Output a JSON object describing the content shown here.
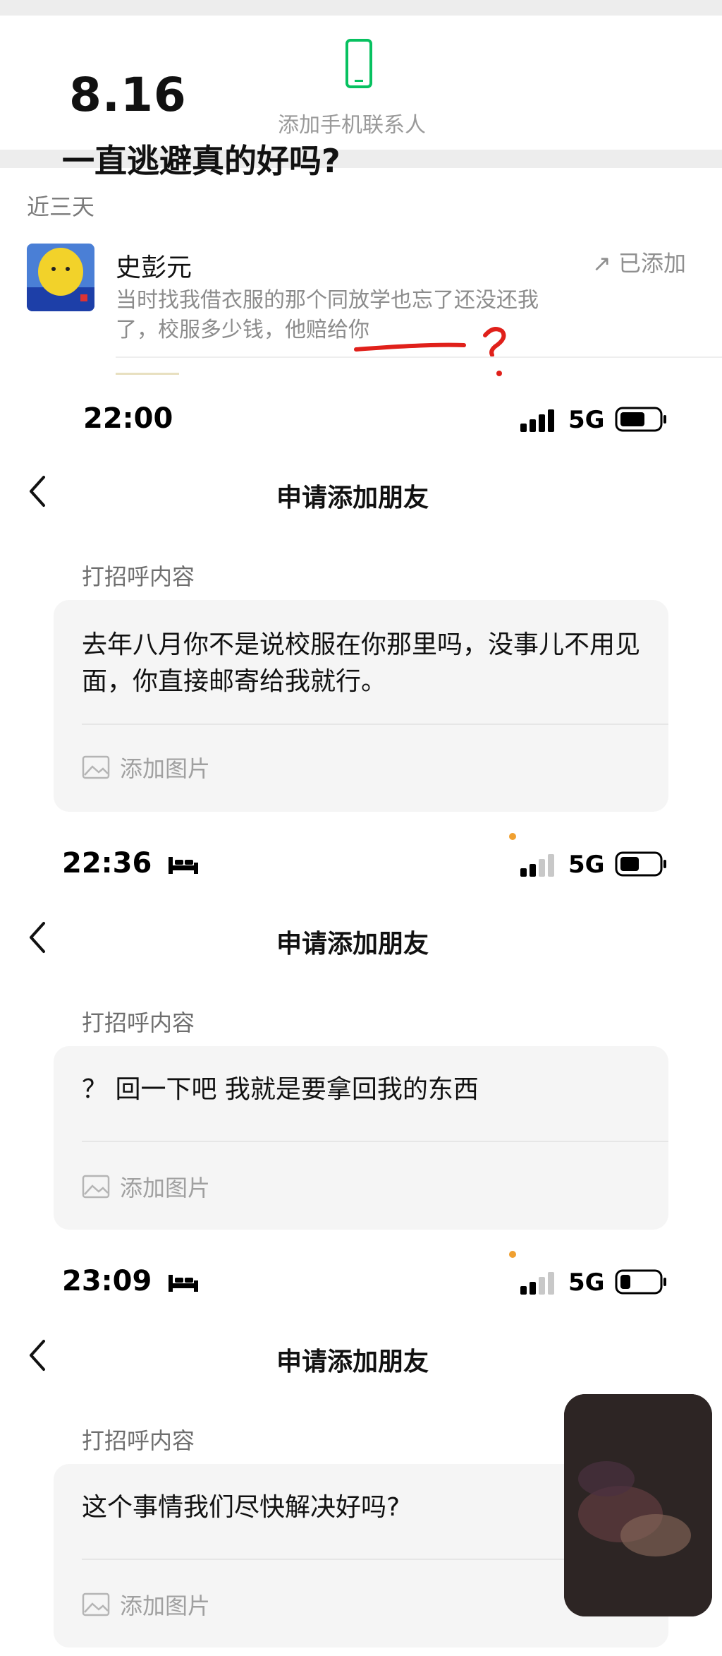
{
  "top_card": {
    "date": "8.16",
    "headline": "一直逃避真的好吗?",
    "add_contact_label": "添加手机联系人",
    "recent_label": "近三天",
    "friend": {
      "name": "史彭元",
      "status": "↗ 已添加",
      "message": "当时找我借衣服的那个同放学也忘了还没还我了，校服多少钱，他赔给你"
    }
  },
  "sections": [
    {
      "time": "22:00",
      "network": "5G",
      "title": "申请添加朋友",
      "greeting_label": "打招呼内容",
      "greeting_text": "去年八月你不是说校服在你那里吗，没事儿不用见面，你直接邮寄给我就行。",
      "add_image": "添加图片"
    },
    {
      "time": "22:36",
      "network": "5G",
      "title": "申请添加朋友",
      "greeting_label": "打招呼内容",
      "greeting_text": "？ 回一下吧 我就是要拿回我的东西",
      "add_image": "添加图片"
    },
    {
      "time": "23:09",
      "network": "5G",
      "title": "申请添加朋友",
      "greeting_label": "打招呼内容",
      "greeting_text": "这个事情我们尽快解决好吗?",
      "add_image": "添加图片"
    }
  ],
  "icons": {
    "phone": "phone-icon",
    "back": "chevron-left-icon",
    "signal": "signal-icon",
    "battery": "battery-icon",
    "bed": "bed-icon",
    "image": "image-icon"
  },
  "colors": {
    "wechat_green": "#07c160",
    "annotation_red": "#e0201a",
    "card_bg": "#f5f5f5"
  }
}
